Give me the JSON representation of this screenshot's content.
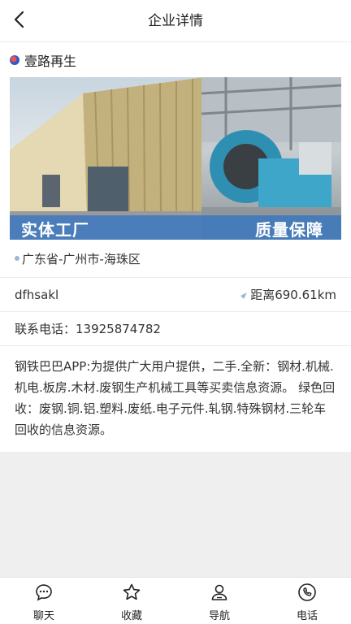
{
  "header": {
    "title": "企业详情",
    "back_icon": "chevron-left-icon"
  },
  "company": {
    "name": "壹路再生",
    "logo_icon": "company-logo-icon"
  },
  "banner": {
    "left_label": "实体工厂",
    "right_label": "质量保障"
  },
  "info": {
    "address": "广东省-广州市-海珠区",
    "contact_name": "dfhsakl",
    "distance": "距离690.61km",
    "phone": "联系电话：13925874782",
    "description": "钢铁巴巴APP:为提供广大用户提供，二手.全新：钢材.机械.机电.板房.木材.废钢生产机械工具等买卖信息资源。 绿色回收：废钢.铜.铝.塑料.废纸.电子元件.轧钢.特殊钢材.三轮车回收的信息资源。"
  },
  "tabs": [
    {
      "label": "聊天",
      "icon": "chat-icon"
    },
    {
      "label": "收藏",
      "icon": "star-icon"
    },
    {
      "label": "导航",
      "icon": "person-icon"
    },
    {
      "label": "电话",
      "icon": "phone-icon"
    }
  ]
}
